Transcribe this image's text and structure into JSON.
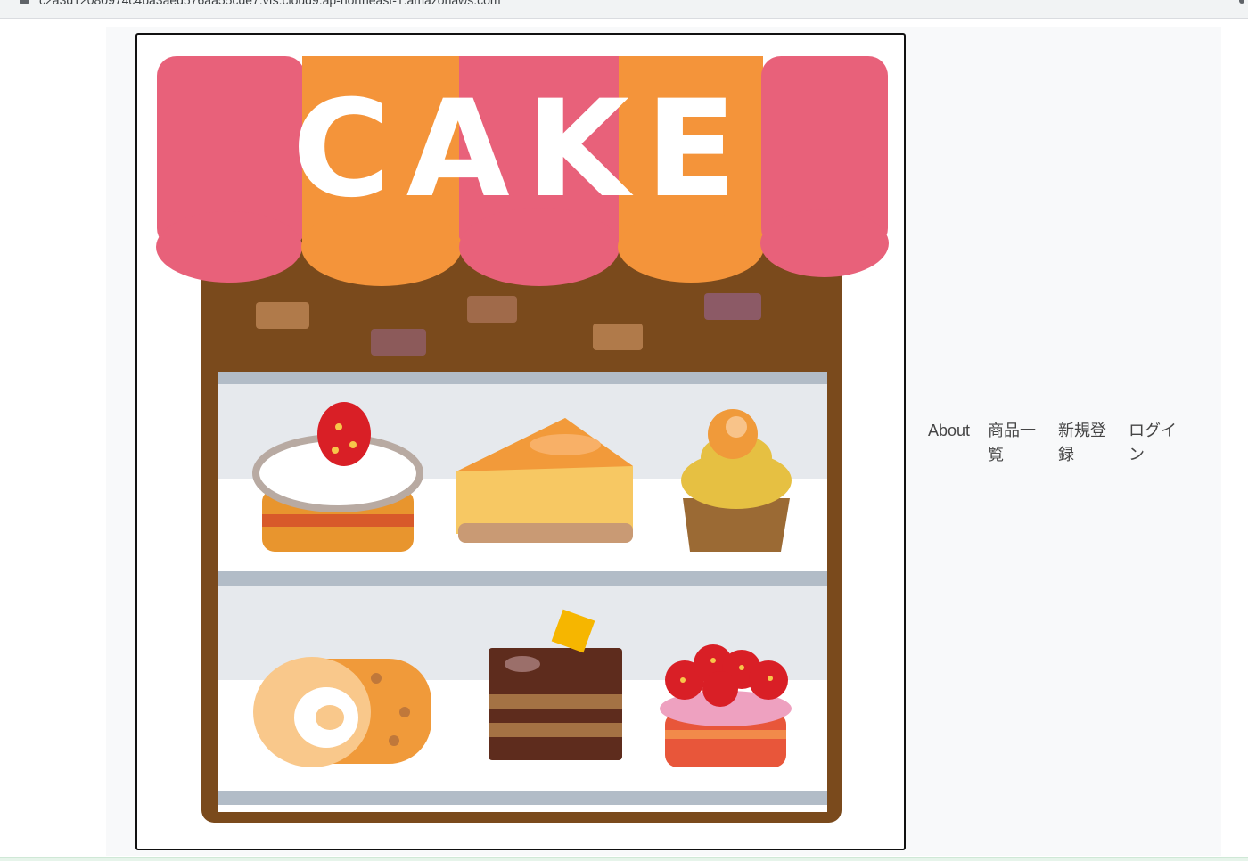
{
  "browser": {
    "url": "c2a3d12080974c4ba3aed576aa55cde7.vfs.cloud9.ap-northeast-1.amazonaws.com"
  },
  "header": {
    "logo": {
      "sign_text": "CAKE",
      "colors": {
        "awning_pink": "#e8617a",
        "awning_orange": "#f4943a",
        "brown": "#7a4a1c",
        "case": "#e6e9ed",
        "frame": "#111111"
      }
    },
    "nav": {
      "about": "About",
      "products": "商品一覧",
      "register": "新規登録",
      "login": "ログイン"
    }
  }
}
